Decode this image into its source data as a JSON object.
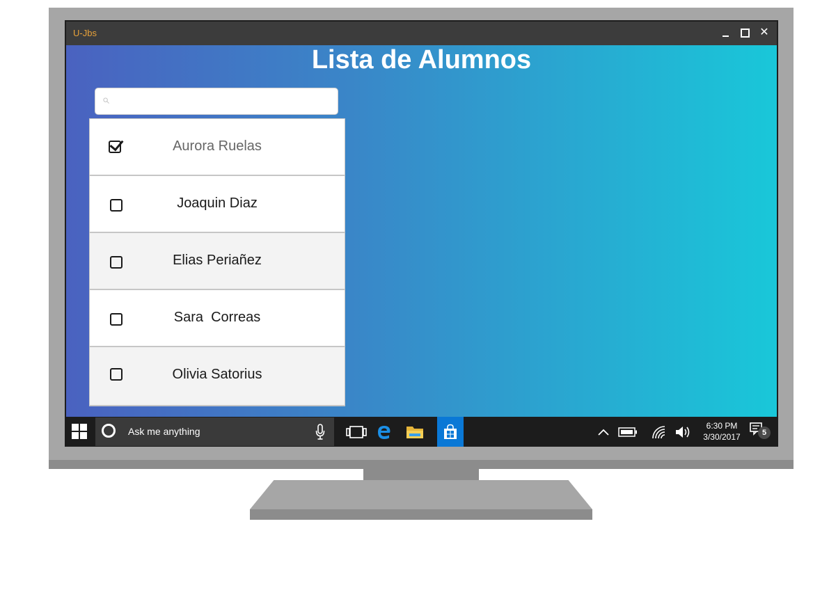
{
  "window": {
    "app_title": "U-Jbs"
  },
  "page": {
    "title": "Lista de Alumnos"
  },
  "search": {
    "value": "",
    "placeholder": ""
  },
  "students": [
    {
      "name": "Aurora Ruelas",
      "checked": true
    },
    {
      "name": "Joaquin Diaz",
      "checked": false
    },
    {
      "name": "Elias Periañez",
      "checked": false
    },
    {
      "name": "Sara  Correas",
      "checked": false
    },
    {
      "name": "Olivia Satorius",
      "checked": false
    }
  ],
  "taskbar": {
    "search_placeholder": "Ask me anything",
    "time": "6:30 PM",
    "date": "3/30/2017",
    "notification_count": "5",
    "pinned_icons": [
      "task-view-icon",
      "edge-icon",
      "file-explorer-icon",
      "store-icon"
    ],
    "tray_icons": [
      "chevron-up-icon",
      "battery-icon",
      "wifi-icon",
      "volume-icon",
      "notification-icon"
    ]
  },
  "colors": {
    "title_accent": "#e8a23a",
    "gradient_start": "#4a62c0",
    "gradient_end": "#19c7d9",
    "taskbar": "#1c1c1c",
    "store_tile": "#0a78d6"
  }
}
